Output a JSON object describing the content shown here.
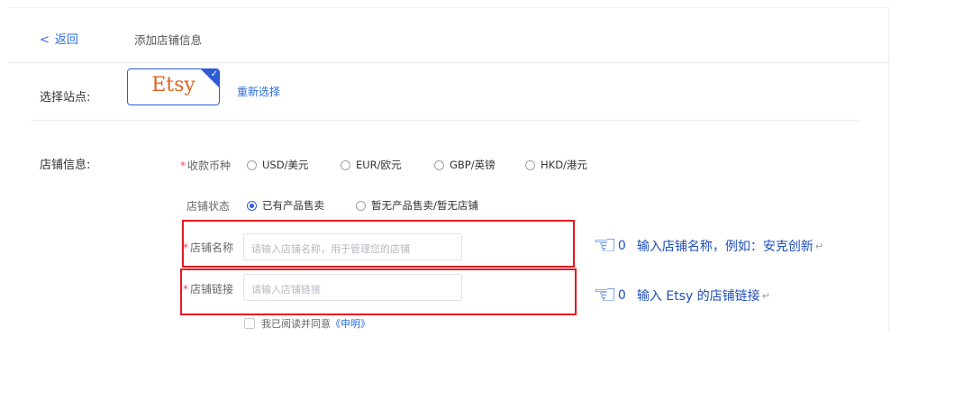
{
  "header": {
    "back_icon": "chevron-left-icon",
    "back_label": "返回",
    "page_title": "添加店铺信息"
  },
  "site": {
    "label": "选择站点:",
    "selected_site": "Etsy",
    "check_icon": "check-icon",
    "reselect_label": "重新选择"
  },
  "store_info": {
    "section_label": "店铺信息:",
    "currency": {
      "required_mark": "*",
      "label": "收款币种",
      "options": [
        "USD/美元",
        "EUR/欧元",
        "GBP/英镑",
        "HKD/港元"
      ],
      "selected": null
    },
    "status": {
      "label": "店铺状态",
      "options": [
        "已有产品售卖",
        "暂无产品售卖/暂无店铺"
      ],
      "selected_index": 0
    },
    "name": {
      "required_mark": "*",
      "label": "店铺名称",
      "placeholder": "请输入店铺名称，用于管理您的店铺"
    },
    "link": {
      "required_mark": "*",
      "label": "店铺链接",
      "placeholder": "请输入店铺链接"
    },
    "agreement": {
      "text": "我已阅读并同意",
      "link_label": "《申明》"
    }
  },
  "annotations": {
    "hand_icon": "pointing-hand-icon",
    "marker": "0",
    "return_glyph": "↵",
    "name_note": "输入店铺名称，例如：安克创新",
    "link_note": "输入 Etsy 的店铺链接"
  },
  "colors": {
    "accent": "#2f5ad8",
    "etsy_orange": "#e0621d",
    "highlight_red": "#e8191f",
    "required_red": "#f04a4a"
  }
}
